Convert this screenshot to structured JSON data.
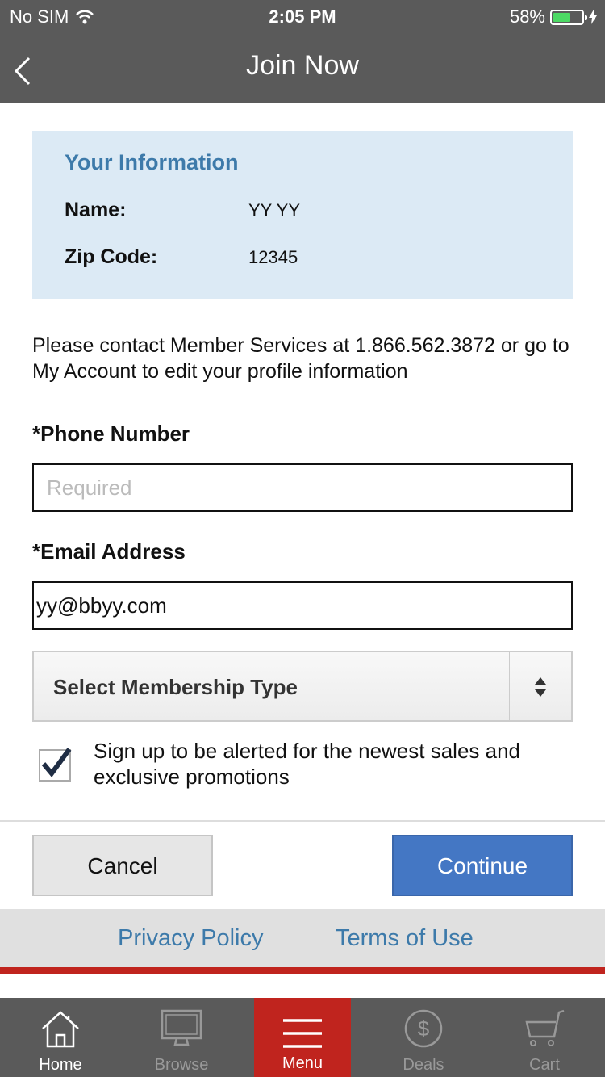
{
  "status_bar": {
    "carrier": "No SIM",
    "time": "2:05 PM",
    "battery_percent": "58%",
    "battery_level": 0.58,
    "wifi_icon": "wifi-icon"
  },
  "nav": {
    "title": "Join Now",
    "back_icon": "chevron-left-icon"
  },
  "your_information": {
    "heading": "Your Information",
    "name_label": "Name:",
    "name_value": "YY  YY",
    "zip_label": "Zip Code:",
    "zip_value": "12345"
  },
  "contact_note": "Please contact Member Services at 1.866.562.3872 or go to My Account to edit your profile information",
  "phone": {
    "label": "*Phone Number",
    "value": "",
    "placeholder": "Required"
  },
  "email": {
    "label": "*Email Address",
    "value": "yy@bbyy.com"
  },
  "membership_select": {
    "selected": "Select Membership Type"
  },
  "alerts_checkbox": {
    "checked": true,
    "label": "Sign up to be alerted for the newest sales and exclusive promotions"
  },
  "buttons": {
    "cancel": "Cancel",
    "continue": "Continue"
  },
  "footer_links": {
    "privacy": "Privacy Policy",
    "terms": "Terms of Use"
  },
  "tabbar": {
    "items": [
      {
        "label": "Home",
        "icon": "home-icon",
        "active": true
      },
      {
        "label": "Browse",
        "icon": "monitor-icon",
        "active": false
      },
      {
        "label": "Menu",
        "icon": "hamburger-icon",
        "active": false
      },
      {
        "label": "Deals",
        "icon": "dollar-icon",
        "active": false
      },
      {
        "label": "Cart",
        "icon": "cart-icon",
        "active": false
      }
    ]
  },
  "colors": {
    "header_bg": "#5a5a5a",
    "info_bg": "#dceaf5",
    "link_blue": "#3d7aaa",
    "continue_blue": "#4477c4",
    "brand_red": "#c0241e"
  }
}
